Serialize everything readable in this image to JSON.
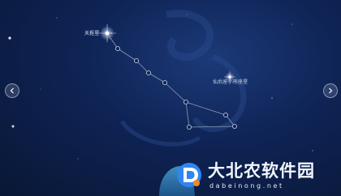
{
  "labels": {
    "dubhe": "天枢星",
    "planet": "仙后座小熊座星"
  },
  "nav": {
    "previous_icon": "chevron-left-icon",
    "next_icon": "chevron-right-icon"
  },
  "watermark": {
    "title": "大北农软件园",
    "url": "dabeinong.net"
  },
  "colors": {
    "sky_deep": "#091735",
    "sky_mid": "#0f2456",
    "sky_glow": "#1c3a78",
    "constellation_line": "#8e9bb8",
    "star": "#ffffff",
    "logo_blue": "#2f86f0",
    "logo_orange": "#f08a24"
  }
}
